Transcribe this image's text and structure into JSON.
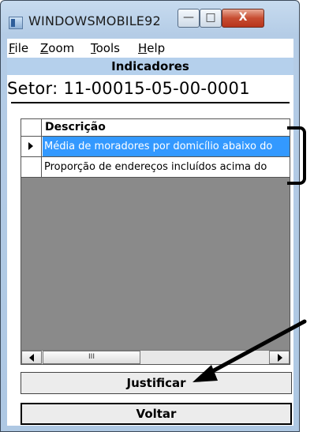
{
  "window": {
    "title": "WINDOWSMOBILE92",
    "controls": {
      "minimize": "—",
      "maximize": "□",
      "close": "X"
    }
  },
  "menu": {
    "items": [
      {
        "label_first": "F",
        "label_rest": "ile"
      },
      {
        "label_first": "Z",
        "label_rest": "oom"
      },
      {
        "label_first": "T",
        "label_rest": "ools"
      },
      {
        "label_first": "H",
        "label_rest": "elp"
      }
    ]
  },
  "header": {
    "title": "Indicadores"
  },
  "setor": {
    "text": "Setor: 11-00015-05-00-0001"
  },
  "grid": {
    "column_header": "Descrição",
    "rows": [
      {
        "text": "Média de moradores por domicílio abaixo do",
        "selected": true
      },
      {
        "text": "Proporção de endereços incluídos acima do",
        "selected": false
      }
    ],
    "scroll_thumb_label": "III"
  },
  "buttons": {
    "justificar": "Justificar",
    "voltar": "Voltar"
  },
  "colors": {
    "selection": "#3399ff",
    "header_band": "#b5d0ec",
    "grid_background": "#8a8a8a"
  }
}
